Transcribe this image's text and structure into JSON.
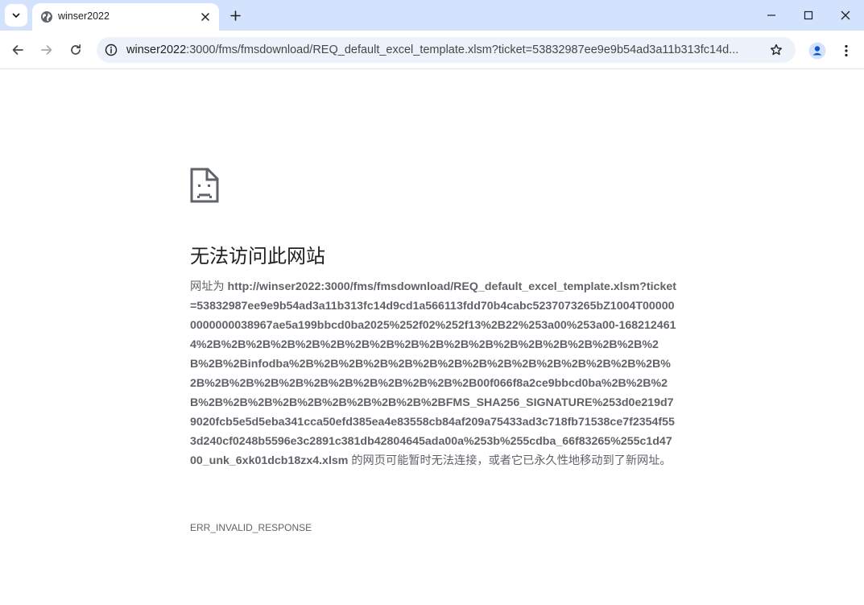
{
  "browser": {
    "tab": {
      "title": "winser2022"
    },
    "omnibox": {
      "host": "winser2022",
      "rest": ":3000/fms/fmsdownload/REQ_default_excel_template.xlsm?ticket=53832987ee9e9b54ad3a11b313fc14d..."
    },
    "icons": {
      "tab_search": "chevron-down-icon",
      "favicon": "globe-icon",
      "tab_close": "close-icon",
      "new_tab": "plus-icon",
      "back": "arrow-left-icon",
      "forward": "arrow-right-icon",
      "reload": "reload-icon",
      "site_info": "info-icon",
      "bookmark": "star-icon",
      "profile": "person-icon",
      "menu": "kebab-menu-icon"
    }
  },
  "error": {
    "icon": "sad-page-icon",
    "heading": "无法访问此网站",
    "prefix": "网址为 ",
    "url": "http://winser2022:3000/fms/fmsdownload/REQ_default_excel_template.xlsm?ticket=53832987ee9e9b54ad3a11b313fc14d9cd1a566113fdd70b4cabc5237073265bZ1004T000000000000038967ae5a199bbcd0ba2025%252f02%252f13%2B22%253a00%253a00-1682124614%2B%2B%2B%2B%2B%2B%2B%2B%2B%2B%2B%2B%2B%2B%2B%2B%2B%2B%2B%2B%2Binfodba%2B%2B%2B%2B%2B%2B%2B%2B%2B%2B%2B%2B%2B%2B%2B%2B%2B%2B%2B%2B%2B%2B%2B%2B%2B%2B%2B00f066f8a2ce9bbcd0ba%2B%2B%2B%2B%2B%2B%2B%2B%2B%2B%2B%2B%2BFMS_SHA256_SIGNATURE%253d0e219d79020fcb5e5d5eba341cca50efd385ea4e83558cb84af209a75433ad3c718fb71538ce7f2354f553d240cf0248b5596e3c2891c381db42804645ada00a%253b%255cdba_66f83265%255c1d4700_unk_6xk01dcb18zx4.xlsm",
    "suffix": " 的网页可能暂时无法连接，或者它已永久性地移动到了新网址。",
    "code": "ERR_INVALID_RESPONSE"
  },
  "colors": {
    "tabstrip_bg": "#d3e3fd",
    "omnibox_bg": "#edf2fa",
    "text_muted": "#5f6368",
    "heading": "#202124"
  }
}
